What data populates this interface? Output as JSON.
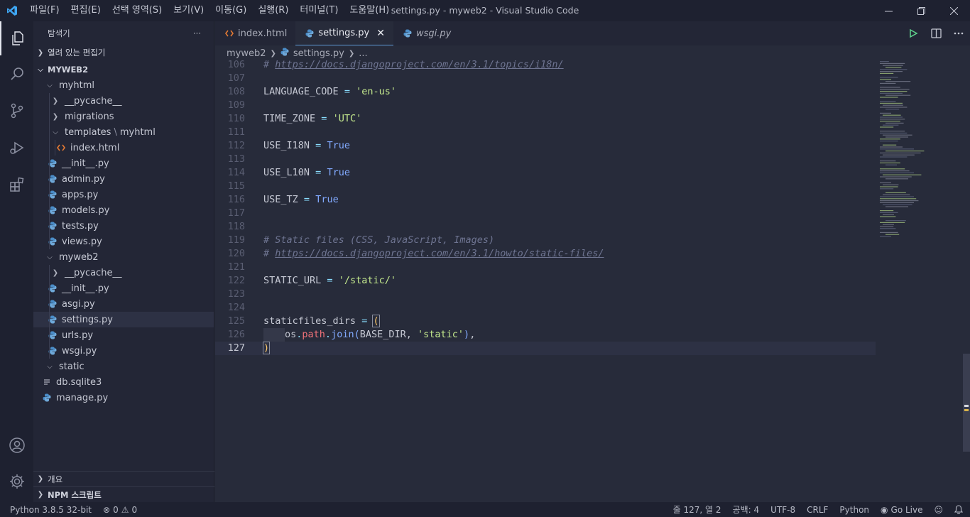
{
  "window": {
    "title": "settings.py - myweb2 - Visual Studio Code",
    "menu": [
      "파일(F)",
      "편집(E)",
      "선택 영역(S)",
      "보기(V)",
      "이동(G)",
      "실행(R)",
      "터미널(T)",
      "도움말(H)"
    ]
  },
  "sidebar": {
    "title": "탐색기",
    "more": "···",
    "open_editors": "열려 있는 편집기",
    "project": "MYWEB2",
    "tree": [
      {
        "label": "myhtml",
        "type": "folder-open"
      },
      {
        "label": "__pycache__",
        "type": "folder"
      },
      {
        "label": "migrations",
        "type": "folder"
      },
      {
        "label": "templates",
        "label2": "myhtml",
        "sep": "\\",
        "type": "folder-open"
      },
      {
        "label": "index.html",
        "type": "html"
      },
      {
        "label": "__init__.py",
        "type": "py"
      },
      {
        "label": "admin.py",
        "type": "py"
      },
      {
        "label": "apps.py",
        "type": "py"
      },
      {
        "label": "models.py",
        "type": "py"
      },
      {
        "label": "tests.py",
        "type": "py"
      },
      {
        "label": "views.py",
        "type": "py"
      },
      {
        "label": "myweb2",
        "type": "folder-open"
      },
      {
        "label": "__pycache__",
        "type": "folder"
      },
      {
        "label": "__init__.py",
        "type": "py"
      },
      {
        "label": "asgi.py",
        "type": "py"
      },
      {
        "label": "settings.py",
        "type": "py"
      },
      {
        "label": "urls.py",
        "type": "py"
      },
      {
        "label": "wsgi.py",
        "type": "py"
      },
      {
        "label": "static",
        "type": "folder-open"
      },
      {
        "label": "db.sqlite3",
        "type": "file"
      },
      {
        "label": "manage.py",
        "type": "py"
      }
    ],
    "outline": "개요",
    "npm": "NPM 스크립트"
  },
  "tabs": [
    {
      "label": "index.html",
      "type": "html"
    },
    {
      "label": "settings.py",
      "type": "py",
      "close": "✕"
    },
    {
      "label": "wsgi.py",
      "type": "py"
    }
  ],
  "breadcrumb": {
    "folder": "myweb2",
    "file": "settings.py",
    "rest": "..."
  },
  "code": {
    "lines": [
      {
        "n": "106",
        "url": "https://docs.djangoproject.com/en/3.1/topics/i18n/"
      },
      {
        "n": "107"
      },
      {
        "n": "108",
        "name": "LANGUAGE_CODE",
        "op": "=",
        "str": "'en-us'"
      },
      {
        "n": "109"
      },
      {
        "n": "110",
        "name": "TIME_ZONE",
        "op": "=",
        "str": "'UTC'"
      },
      {
        "n": "111"
      },
      {
        "n": "112",
        "name": "USE_I18N",
        "op": "=",
        "kw": "True"
      },
      {
        "n": "113"
      },
      {
        "n": "114",
        "name": "USE_L10N",
        "op": "=",
        "kw": "True"
      },
      {
        "n": "115"
      },
      {
        "n": "116",
        "name": "USE_TZ",
        "op": "=",
        "kw": "True"
      },
      {
        "n": "117"
      },
      {
        "n": "118"
      },
      {
        "n": "119",
        "comment": "# Static files (CSS, JavaScript, Images)"
      },
      {
        "n": "120",
        "url": "https://docs.djangoproject.com/en/3.1/howto/static-files/"
      },
      {
        "n": "121"
      },
      {
        "n": "122",
        "name": "STATIC_URL",
        "op": "=",
        "str": "'/static/'"
      },
      {
        "n": "123"
      },
      {
        "n": "124"
      },
      {
        "n": "125",
        "name": "staticfiles_dirs",
        "op": "=",
        "brk": "("
      },
      {
        "n": "126",
        "os": "os",
        "path": "path",
        "join": "join",
        "arg": "BASE_DIR",
        "str": "'static'"
      },
      {
        "n": "127",
        "brk": ")"
      }
    ]
  },
  "status": {
    "python": "Python 3.8.5 32-bit",
    "errors": "0",
    "warnings": "0",
    "position": "줄 127, 열 2",
    "spaces": "공백: 4",
    "encoding": "UTF-8",
    "eol": "CRLF",
    "language": "Python",
    "golive": "Go Live"
  },
  "colors": {
    "accent": "#5f9ad6",
    "string": "#c3e88d",
    "keyword": "#82aaff",
    "operator": "#89ddff",
    "comment": "#6e7491"
  }
}
